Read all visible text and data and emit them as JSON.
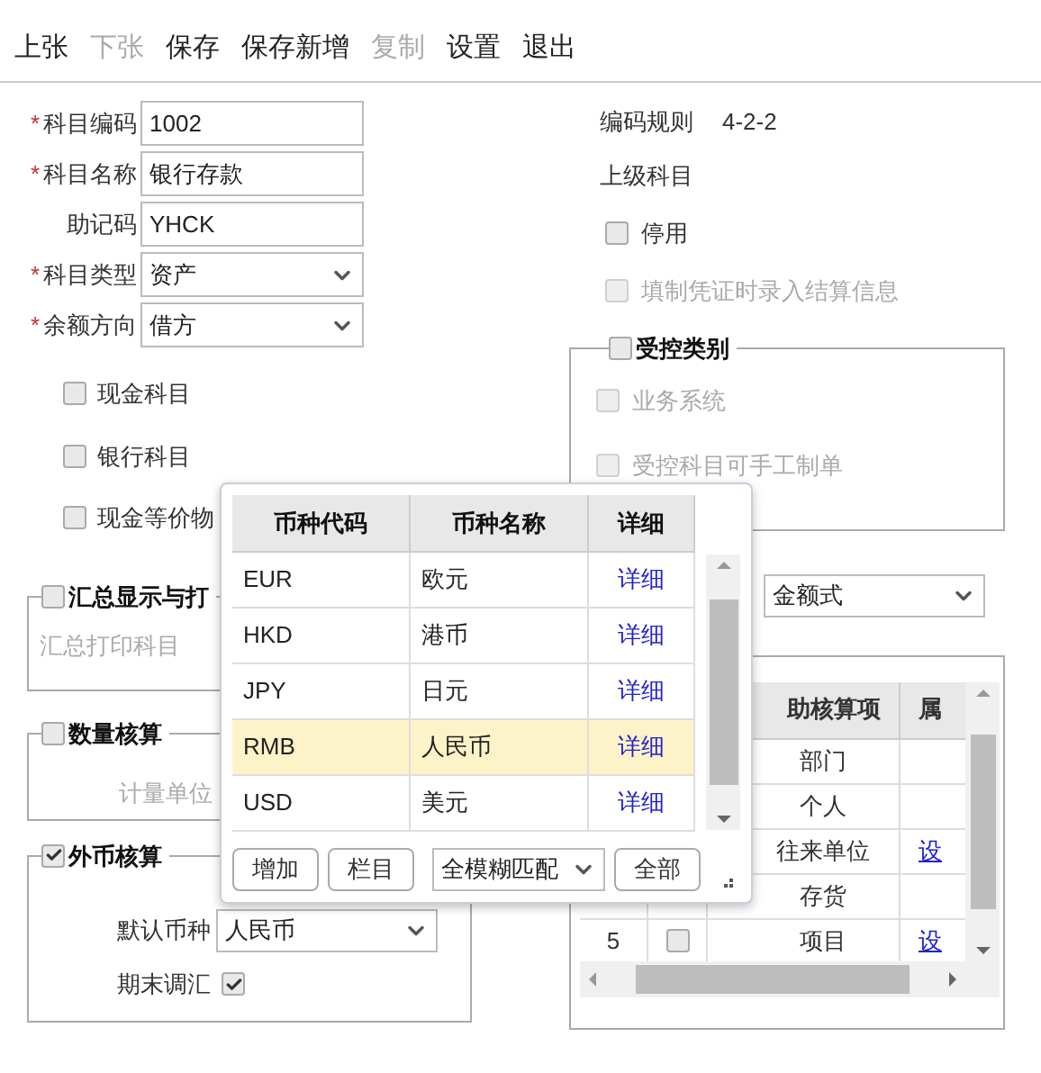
{
  "toolbar": [
    {
      "label": "上张",
      "disabled": false
    },
    {
      "label": "下张",
      "disabled": true
    },
    {
      "label": "保存",
      "disabled": false
    },
    {
      "label": "保存新增",
      "disabled": false
    },
    {
      "label": "复制",
      "disabled": true
    },
    {
      "label": "设置",
      "disabled": false
    },
    {
      "label": "退出",
      "disabled": false
    }
  ],
  "required_mark": "*",
  "fields": [
    {
      "label": "科目编码",
      "required": true,
      "kind": "input",
      "value": "1002"
    },
    {
      "label": "科目名称",
      "required": true,
      "kind": "input",
      "value": "银行存款"
    },
    {
      "label": "助记码",
      "required": false,
      "kind": "input",
      "value": "YHCK"
    },
    {
      "label": "科目类型",
      "required": true,
      "kind": "select",
      "value": "资产"
    },
    {
      "label": "余额方向",
      "required": true,
      "kind": "select",
      "value": "借方"
    }
  ],
  "flags": [
    {
      "label": "现金科目",
      "checked": false
    },
    {
      "label": "银行科目",
      "checked": false
    },
    {
      "label": "现金等价物",
      "checked": false
    }
  ],
  "summary": {
    "title": "汇总显示与打",
    "checked": false,
    "field_label": "汇总打印科目"
  },
  "quantity": {
    "title": "数量核算",
    "checked": false,
    "field_label": "计量单位"
  },
  "foreign": {
    "title": "外币核算",
    "checked": true,
    "currency_label": "默认币种",
    "currency_value": "人民币",
    "adjust_label": "期末调汇",
    "adjust_checked": true
  },
  "coding_rule": {
    "label": "编码规则",
    "value": "4-2-2"
  },
  "parent_label": "上级科目",
  "options": [
    {
      "label": "停用",
      "checked": false,
      "disabled": false
    },
    {
      "label": "填制凭证时录入结算信息",
      "checked": false,
      "disabled": true
    }
  ],
  "controlled": {
    "title": "受控类别",
    "checked": false,
    "options": [
      {
        "label": "业务系统",
        "checked": false
      },
      {
        "label": "受控科目可手工制单",
        "checked": false
      }
    ]
  },
  "amount_format": "金额式",
  "aux_table": {
    "columns": [
      "助核算项",
      "属"
    ],
    "rows": [
      {
        "item": "部门"
      },
      {
        "item": "个人"
      },
      {
        "item": "往来单位",
        "attribute": "设"
      },
      {
        "item": "存货"
      },
      {
        "number": "5",
        "checked": false,
        "item": "项目",
        "attribute": "设"
      }
    ]
  },
  "popup": {
    "columns": [
      "币种代码",
      "币种名称",
      "详细"
    ],
    "rows": [
      {
        "code": "EUR",
        "name": "欧元",
        "detail": "详细",
        "selected": false
      },
      {
        "code": "HKD",
        "name": "港币",
        "detail": "详细",
        "selected": false
      },
      {
        "code": "JPY",
        "name": "日元",
        "detail": "详细",
        "selected": false
      },
      {
        "code": "RMB",
        "name": "人民币",
        "detail": "详细",
        "selected": true
      },
      {
        "code": "USD",
        "name": "美元",
        "detail": "详细",
        "selected": false
      }
    ],
    "buttons": [
      "增加",
      "栏目"
    ],
    "match_mode": "全模糊匹配",
    "all_button": "全部"
  }
}
